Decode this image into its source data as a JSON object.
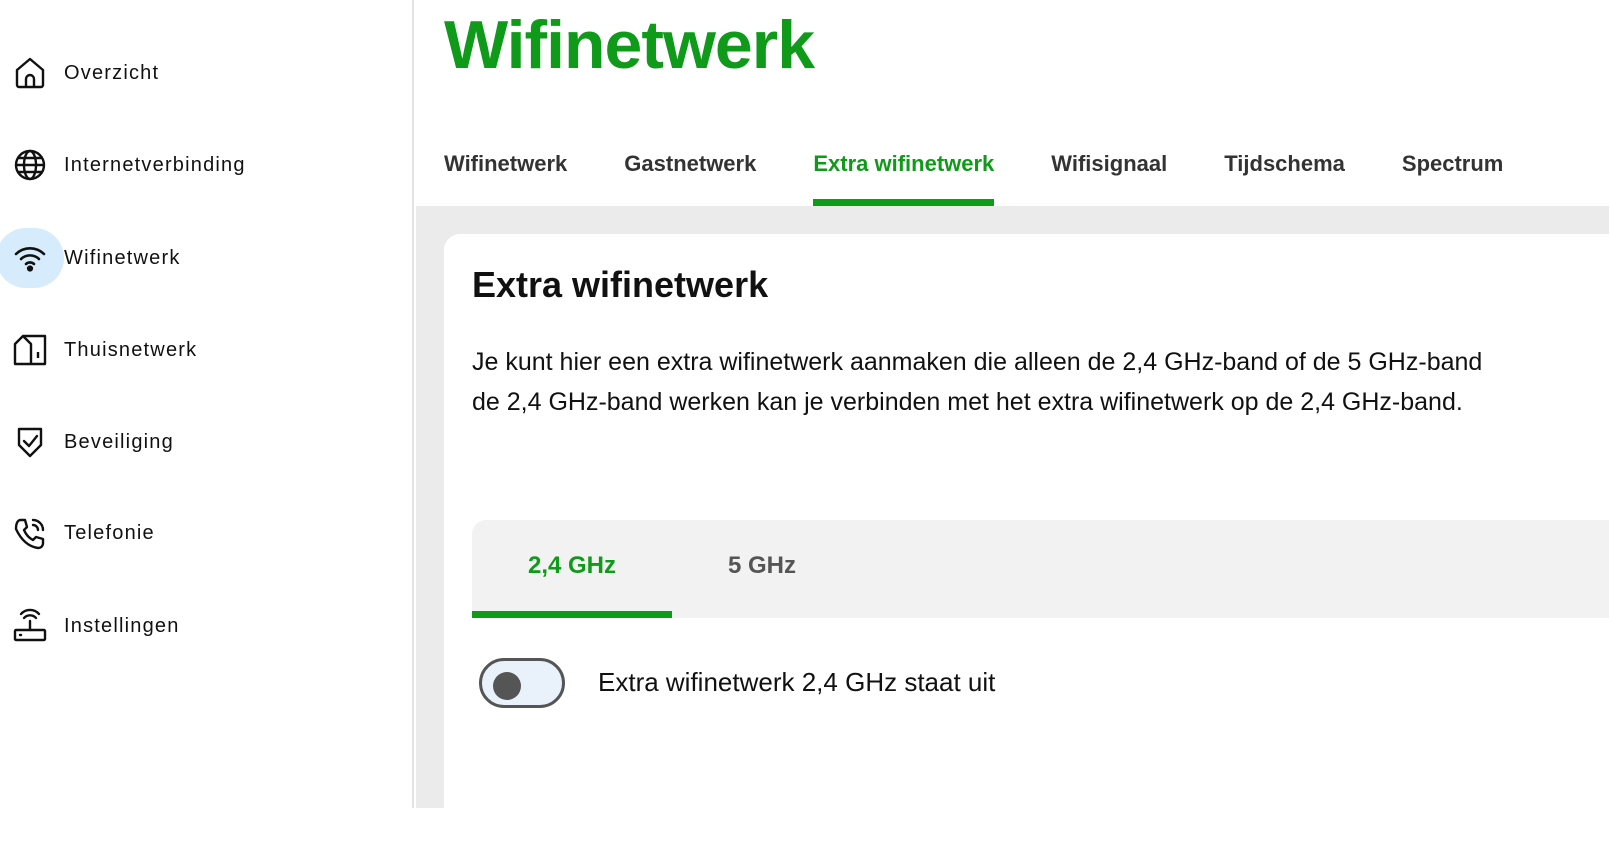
{
  "sidebar": {
    "items": [
      {
        "label": "Overzicht",
        "icon": "home-icon"
      },
      {
        "label": "Internetverbinding",
        "icon": "globe-icon"
      },
      {
        "label": "Wifinetwerk",
        "icon": "wifi-icon",
        "active": true
      },
      {
        "label": "Thuisnetwerk",
        "icon": "house-network-icon"
      },
      {
        "label": "Beveiliging",
        "icon": "shield-check-icon"
      },
      {
        "label": "Telefonie",
        "icon": "phone-icon"
      },
      {
        "label": "Instellingen",
        "icon": "router-icon"
      }
    ]
  },
  "header": {
    "title": "Wifinetwerk",
    "tabs": [
      {
        "label": "Wifinetwerk"
      },
      {
        "label": "Gastnetwerk"
      },
      {
        "label": "Extra wifinetwerk",
        "active": true
      },
      {
        "label": "Wifisignaal"
      },
      {
        "label": "Tijdschema"
      },
      {
        "label": "Spectrum"
      }
    ]
  },
  "card": {
    "title": "Extra wifinetwerk",
    "description_line1": "Je kunt hier een extra wifinetwerk aanmaken die alleen de 2,4 GHz-band of de 5 GHz-band",
    "description_line2": "de 2,4 GHz-band werken kan je verbinden met het extra wifinetwerk op de 2,4 GHz-band.",
    "band_tabs": [
      {
        "label": "2,4 GHz",
        "active": true
      },
      {
        "label": "5 GHz"
      }
    ],
    "toggle": {
      "state": "off",
      "label": "Extra wifinetwerk 2,4 GHz staat uit"
    }
  },
  "colors": {
    "accent": "#0f9a1a",
    "active_nav_bg": "#d6ebfb",
    "page_bg": "#ebebeb",
    "text": "#111111"
  }
}
